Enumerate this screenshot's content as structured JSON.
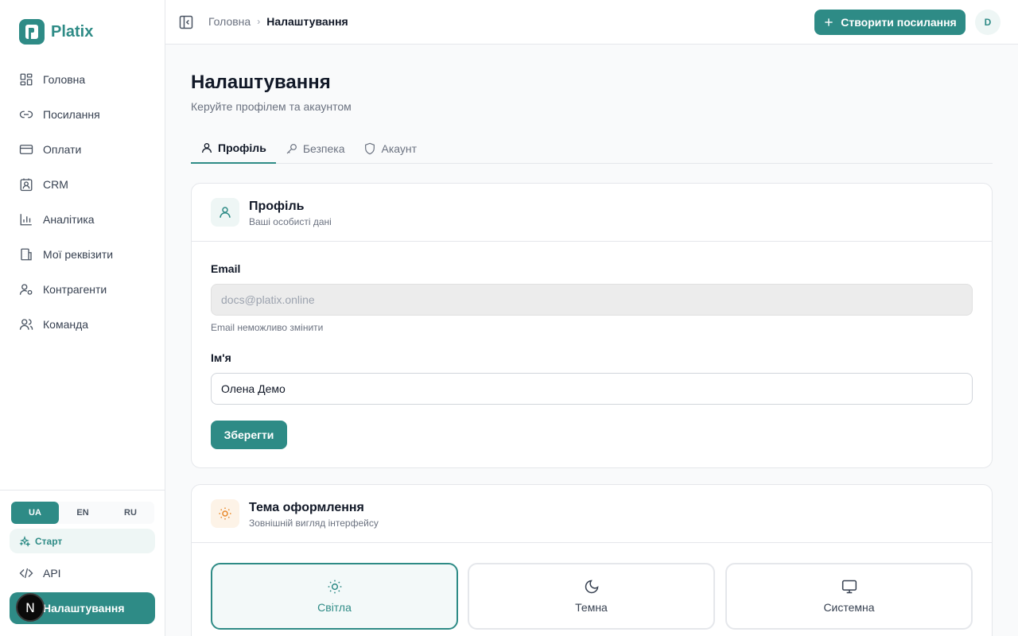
{
  "brand": {
    "name": "Platix",
    "logo_letter": "P"
  },
  "sidebar": {
    "items": [
      {
        "label": "Головна",
        "icon": "dashboard-icon"
      },
      {
        "label": "Посилання",
        "icon": "link-icon"
      },
      {
        "label": "Оплати",
        "icon": "credit-card-icon"
      },
      {
        "label": "CRM",
        "icon": "contact-icon"
      },
      {
        "label": "Аналітика",
        "icon": "bar-chart-icon"
      },
      {
        "label": "Мої реквізити",
        "icon": "building-icon"
      },
      {
        "label": "Контрагенти",
        "icon": "user-cog-icon"
      },
      {
        "label": "Команда",
        "icon": "users-icon"
      }
    ],
    "languages": [
      "UA",
      "EN",
      "RU"
    ],
    "active_language": "UA",
    "start_label": "Старт",
    "api_label": "API",
    "settings_label": "Налаштування",
    "next_badge": "N"
  },
  "topbar": {
    "breadcrumb_home": "Головна",
    "breadcrumb_separator": "›",
    "breadcrumb_current": "Налаштування",
    "create_button": "Створити посилання",
    "avatar_initial": "D"
  },
  "page": {
    "title": "Налаштування",
    "subtitle": "Керуйте профілем та акаунтом"
  },
  "tabs": [
    {
      "label": "Профіль",
      "icon": "user-icon",
      "active": true
    },
    {
      "label": "Безпека",
      "icon": "key-icon",
      "active": false
    },
    {
      "label": "Акаунт",
      "icon": "shield-icon",
      "active": false
    }
  ],
  "profile_card": {
    "title": "Профіль",
    "description": "Ваші особисті дані",
    "email_label": "Email",
    "email_value": "docs@platix.online",
    "email_hint": "Email неможливо змінити",
    "name_label": "Ім'я",
    "name_value": "Олена Демо",
    "save_button": "Зберегти"
  },
  "theme_card": {
    "title": "Тема оформлення",
    "description": "Зовнішній вигляд інтерфейсу",
    "options": [
      {
        "label": "Світла",
        "icon": "sun-icon",
        "active": true
      },
      {
        "label": "Темна",
        "icon": "moon-icon",
        "active": false
      },
      {
        "label": "Системна",
        "icon": "monitor-icon",
        "active": false
      }
    ]
  },
  "colors": {
    "accent": "#2e8b86",
    "accent_light": "#eef6f5",
    "theme_icon_bg": "#fdf3e7",
    "theme_icon": "#e8892b"
  }
}
